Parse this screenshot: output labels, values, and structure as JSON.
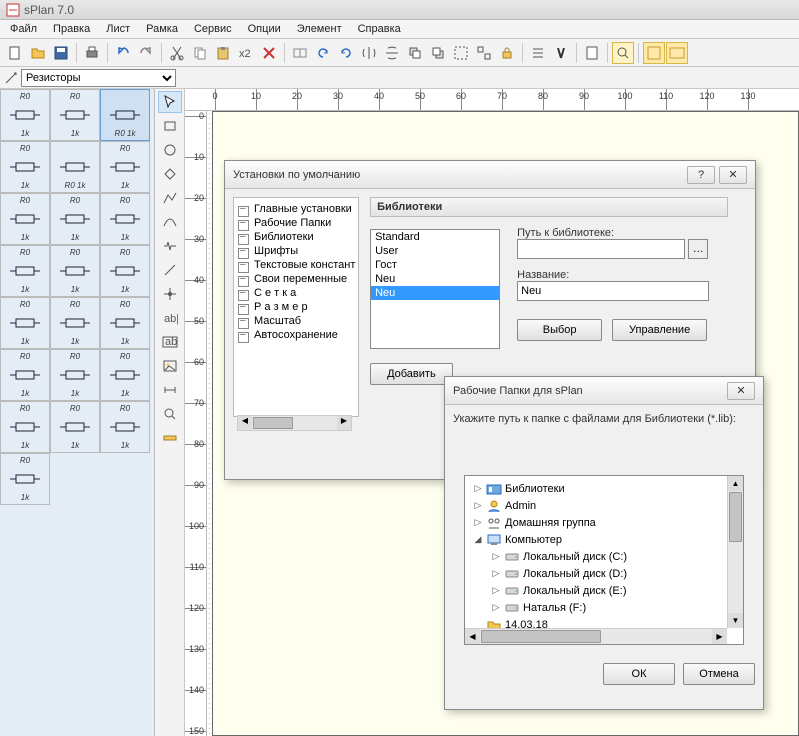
{
  "app_title": "sPlan 7.0",
  "menu": [
    "Файл",
    "Правка",
    "Лист",
    "Рамка",
    "Сервис",
    "Опции",
    "Элемент",
    "Справка"
  ],
  "library_combo": "Резисторы",
  "hruler_ticks": [
    0,
    10,
    20,
    30,
    40,
    50,
    60,
    70,
    80,
    90,
    100,
    110,
    120,
    130
  ],
  "vruler_ticks": [
    0,
    10,
    20,
    30,
    40,
    50,
    60,
    70,
    80,
    90,
    100,
    110,
    120,
    130,
    140,
    150
  ],
  "palette_items": [
    {
      "l1": "R0",
      "l2": "1k"
    },
    {
      "l1": "R0",
      "l2": "1k"
    },
    {
      "l1": "",
      "l2": "R0 1k"
    },
    {
      "l1": "R0",
      "l2": "1k"
    },
    {
      "l1": "",
      "l2": "R0 1k"
    },
    {
      "l1": "R0",
      "l2": "1k"
    },
    {
      "l1": "R0",
      "l2": "1k"
    },
    {
      "l1": "R0",
      "l2": "1k"
    },
    {
      "l1": "R0",
      "l2": "1k"
    },
    {
      "l1": "R0",
      "l2": "1k"
    },
    {
      "l1": "R0",
      "l2": "1k"
    },
    {
      "l1": "R0",
      "l2": "1k"
    },
    {
      "l1": "R0",
      "l2": "1k"
    },
    {
      "l1": "R0",
      "l2": "1k"
    },
    {
      "l1": "R0",
      "l2": "1k"
    },
    {
      "l1": "R0",
      "l2": "1k"
    },
    {
      "l1": "R0",
      "l2": "1k"
    },
    {
      "l1": "R0",
      "l2": "1k"
    },
    {
      "l1": "R0",
      "l2": "1k"
    },
    {
      "l1": "R0",
      "l2": "1k"
    },
    {
      "l1": "R0",
      "l2": "1k"
    },
    {
      "l1": "R0",
      "l2": "1k"
    }
  ],
  "dlg1": {
    "title": "Установки по умолчанию",
    "tree": [
      "Главные установки",
      "Рабочие Папки",
      "Библиотеки",
      "Шрифты",
      "Текстовые констант",
      "Свои переменные",
      "С е т к а",
      "Р а з м е р",
      "Масштаб",
      "Автосохранение"
    ],
    "group_header": "Библиотеки",
    "list": [
      "Standard",
      "User",
      "Гост",
      "Neu",
      "Neu"
    ],
    "list_sel": 4,
    "path_label": "Путь к библиотеке:",
    "path_value": "",
    "name_label": "Название:",
    "name_value": "Neu",
    "btn_choose": "Выбор",
    "btn_manage": "Управление",
    "btn_add": "Добавить"
  },
  "dlg2": {
    "title": "Рабочие Папки для sPlan",
    "instruction": "Укажите путь к папке с файлами для Библиотеки (*.lib):",
    "tree": [
      {
        "indent": 0,
        "icon": "lib",
        "label": "Библиотеки",
        "arr": "▷"
      },
      {
        "indent": 0,
        "icon": "user",
        "label": "Admin",
        "arr": "▷"
      },
      {
        "indent": 0,
        "icon": "net",
        "label": "Домашняя группа",
        "arr": "▷"
      },
      {
        "indent": 0,
        "icon": "pc",
        "label": "Компьютер",
        "arr": "◢"
      },
      {
        "indent": 1,
        "icon": "disk",
        "label": "Локальный диск (C:)",
        "arr": "▷"
      },
      {
        "indent": 1,
        "icon": "disk",
        "label": "Локальный диск (D:)",
        "arr": "▷"
      },
      {
        "indent": 1,
        "icon": "disk",
        "label": "Локальный диск (E:)",
        "arr": "▷"
      },
      {
        "indent": 1,
        "icon": "disk",
        "label": "Наталья (F:)",
        "arr": "▷"
      },
      {
        "indent": 0,
        "icon": "folder",
        "label": "14.03.18",
        "arr": ""
      }
    ],
    "btn_ok": "ОК",
    "btn_cancel": "Отмена"
  }
}
